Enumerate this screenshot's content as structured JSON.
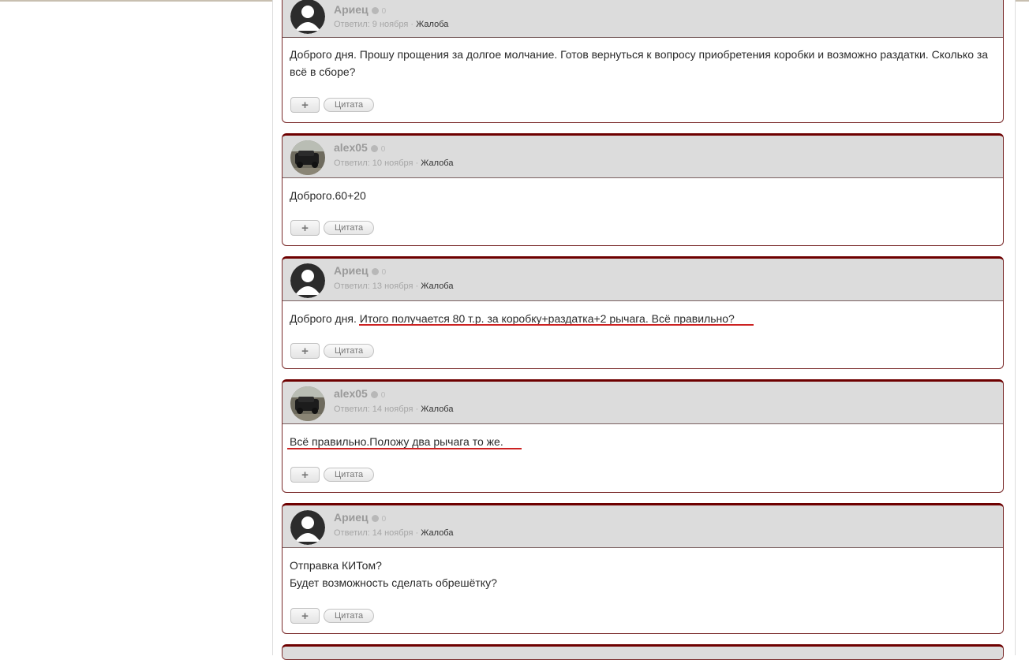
{
  "posts": [
    {
      "author": "Ариец",
      "avatar": "default-user-icon",
      "rep": "0",
      "meta_prefix": "Ответил: 9 ноября · ",
      "complaint": "Жалоба",
      "body": [
        "Доброго дня. Прошу прощения за долгое молчание. Готов вернуться к вопросу приобретения коробки и возможно раздатки. Сколько за всё в сборе?"
      ]
    },
    {
      "author": "alex05",
      "avatar": "car-photo",
      "rep": "0",
      "meta_prefix": "Ответил: 10 ноября · ",
      "complaint": "Жалоба",
      "body": [
        "Доброго.60+20"
      ]
    },
    {
      "author": "Ариец",
      "avatar": "default-user-icon",
      "rep": "0",
      "meta_prefix": "Ответил: 13 ноября · ",
      "complaint": "Жалоба",
      "body": [
        "Доброго дня. Итого получается 80 т.р. за коробку+раздатка+2 рычага. Всё правильно?"
      ]
    },
    {
      "author": "alex05",
      "avatar": "car-photo",
      "rep": "0",
      "meta_prefix": "Ответил: 14 ноября · ",
      "complaint": "Жалоба",
      "body": [
        "Всё правильно.Положу два рычага то же."
      ]
    },
    {
      "author": "Ариец",
      "avatar": "default-user-icon",
      "rep": "0",
      "meta_prefix": "Ответил: 14 ноября · ",
      "complaint": "Жалоба",
      "body": [
        "Отправка КИТом?",
        "Будет возможность сделать обрешётку?"
      ]
    }
  ],
  "buttons": {
    "plus": "+",
    "quote": "Цитата"
  },
  "colors": {
    "post_border": "#6e0000",
    "header_bg": "#dcdcdc",
    "annotation_underline": "#cc2222"
  }
}
